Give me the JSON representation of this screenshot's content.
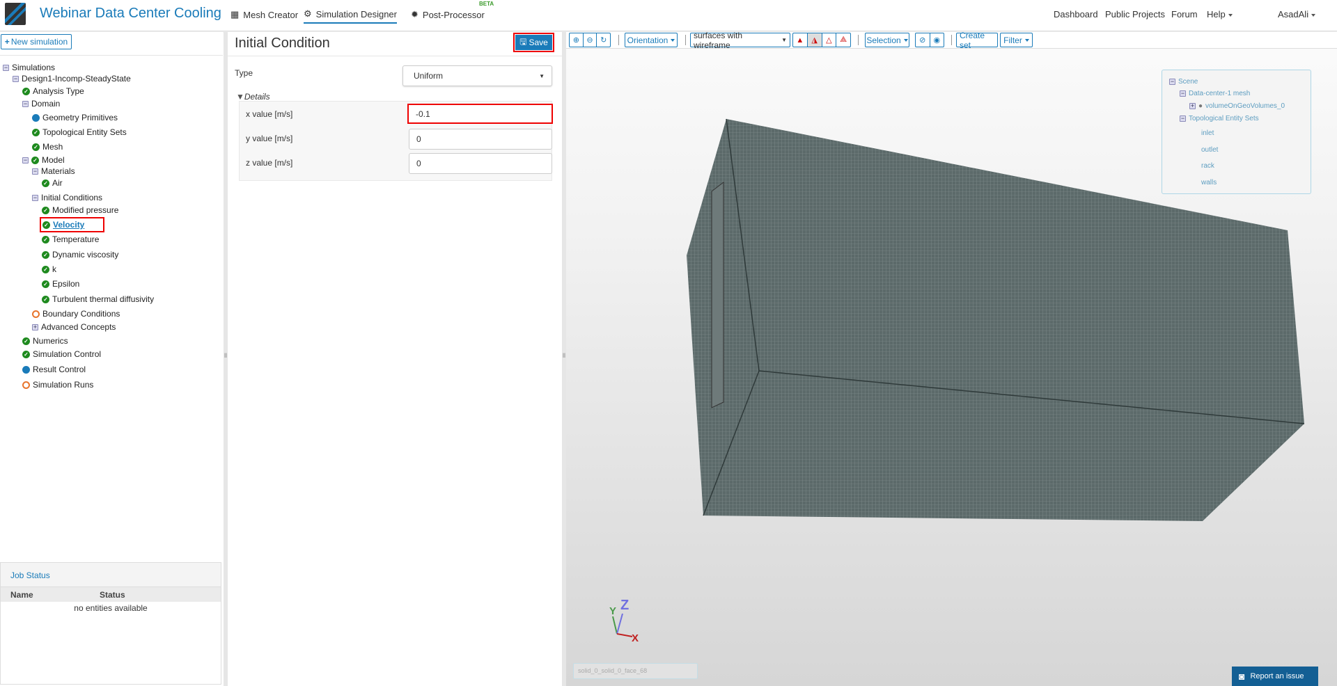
{
  "header": {
    "app_title": "Webinar Data Center Cooling",
    "tabs": [
      {
        "label": "Mesh Creator",
        "icon": "grid-icon"
      },
      {
        "label": "Simulation Designer",
        "icon": "gears-icon",
        "active": true
      },
      {
        "label": "Post-Processor",
        "icon": "gear-icon",
        "badge": "BETA"
      }
    ],
    "nav": [
      "Dashboard",
      "Public Projects",
      "Forum",
      "Help"
    ],
    "user": "AsadAli"
  },
  "sidebar": {
    "new_simulation": "New simulation",
    "tree": [
      {
        "label": "Simulations",
        "level": 0,
        "toggle": "minus",
        "status": ""
      },
      {
        "label": "Design1-Incomp-SteadyState",
        "level": 1,
        "toggle": "minus",
        "status": ""
      },
      {
        "label": "Analysis Type",
        "level": 2,
        "toggle": "",
        "status": "ok"
      },
      {
        "label": "Domain",
        "level": 2,
        "toggle": "minus",
        "status": ""
      },
      {
        "label": "Geometry Primitives",
        "level": 3,
        "toggle": "",
        "status": "blue"
      },
      {
        "label": "Topological Entity Sets",
        "level": 3,
        "toggle": "",
        "status": "ok"
      },
      {
        "label": "Mesh",
        "level": 3,
        "toggle": "",
        "status": "ok"
      },
      {
        "label": "Model",
        "level": 2,
        "toggle": "minus",
        "status": "ok"
      },
      {
        "label": "Materials",
        "level": 3,
        "toggle": "minus",
        "status": ""
      },
      {
        "label": "Air",
        "level": 4,
        "toggle": "",
        "status": "ok"
      },
      {
        "label": "Initial Conditions",
        "level": 3,
        "toggle": "minus",
        "status": ""
      },
      {
        "label": "Modified pressure",
        "level": 4,
        "toggle": "",
        "status": "ok"
      },
      {
        "label": "Velocity",
        "level": 4,
        "toggle": "",
        "status": "ok",
        "selected": true
      },
      {
        "label": "Temperature",
        "level": 4,
        "toggle": "",
        "status": "ok"
      },
      {
        "label": "Dynamic viscosity",
        "level": 4,
        "toggle": "",
        "status": "ok"
      },
      {
        "label": "k",
        "level": 4,
        "toggle": "",
        "status": "ok"
      },
      {
        "label": "Epsilon",
        "level": 4,
        "toggle": "",
        "status": "ok"
      },
      {
        "label": "Turbulent thermal diffusivity",
        "level": 4,
        "toggle": "",
        "status": "ok"
      },
      {
        "label": "Boundary Conditions",
        "level": 3,
        "toggle": "",
        "status": "open"
      },
      {
        "label": "Advanced Concepts",
        "level": 3,
        "toggle": "plus",
        "status": ""
      },
      {
        "label": "Numerics",
        "level": 2,
        "toggle": "",
        "status": "ok"
      },
      {
        "label": "Simulation Control",
        "level": 2,
        "toggle": "",
        "status": "ok"
      },
      {
        "label": "Result Control",
        "level": 2,
        "toggle": "",
        "status": "blue"
      },
      {
        "label": "Simulation Runs",
        "level": 2,
        "toggle": "",
        "status": "open"
      }
    ]
  },
  "job_status": {
    "title": "Job Status",
    "columns": [
      "Name",
      "Status"
    ],
    "empty": "no entities available"
  },
  "form": {
    "title": "Initial Condition",
    "save": "Save",
    "type_label": "Type",
    "type_value": "Uniform",
    "details": "Details",
    "fields": [
      {
        "label": "x value [m/s]",
        "value": "-0.1"
      },
      {
        "label": "y value [m/s]",
        "value": "0"
      },
      {
        "label": "z value [m/s]",
        "value": "0"
      }
    ]
  },
  "viewer": {
    "toolbar": {
      "orientation": "Orientation",
      "render_mode": "surfaces with wireframe",
      "selection": "Selection",
      "create_set": "Create set",
      "filter": "Filter"
    },
    "scene_tree": {
      "root": "Scene",
      "mesh": "Data-center-1 mesh",
      "volume": "volumeOnGeoVolumes_0",
      "sets_label": "Topological Entity Sets",
      "sets": [
        "inlet",
        "outlet",
        "rack",
        "walls"
      ]
    },
    "axes": {
      "x": "X",
      "y": "Y",
      "z": "Z"
    },
    "status_text": "solid_0_solid_0_face_68",
    "report": "Report an issue"
  },
  "colors": {
    "accent": "#1a7bb9",
    "ok": "#1e8a1e",
    "warn": "#e8742c",
    "highlight": "#e00000",
    "mesh": "#5c6a6a"
  }
}
